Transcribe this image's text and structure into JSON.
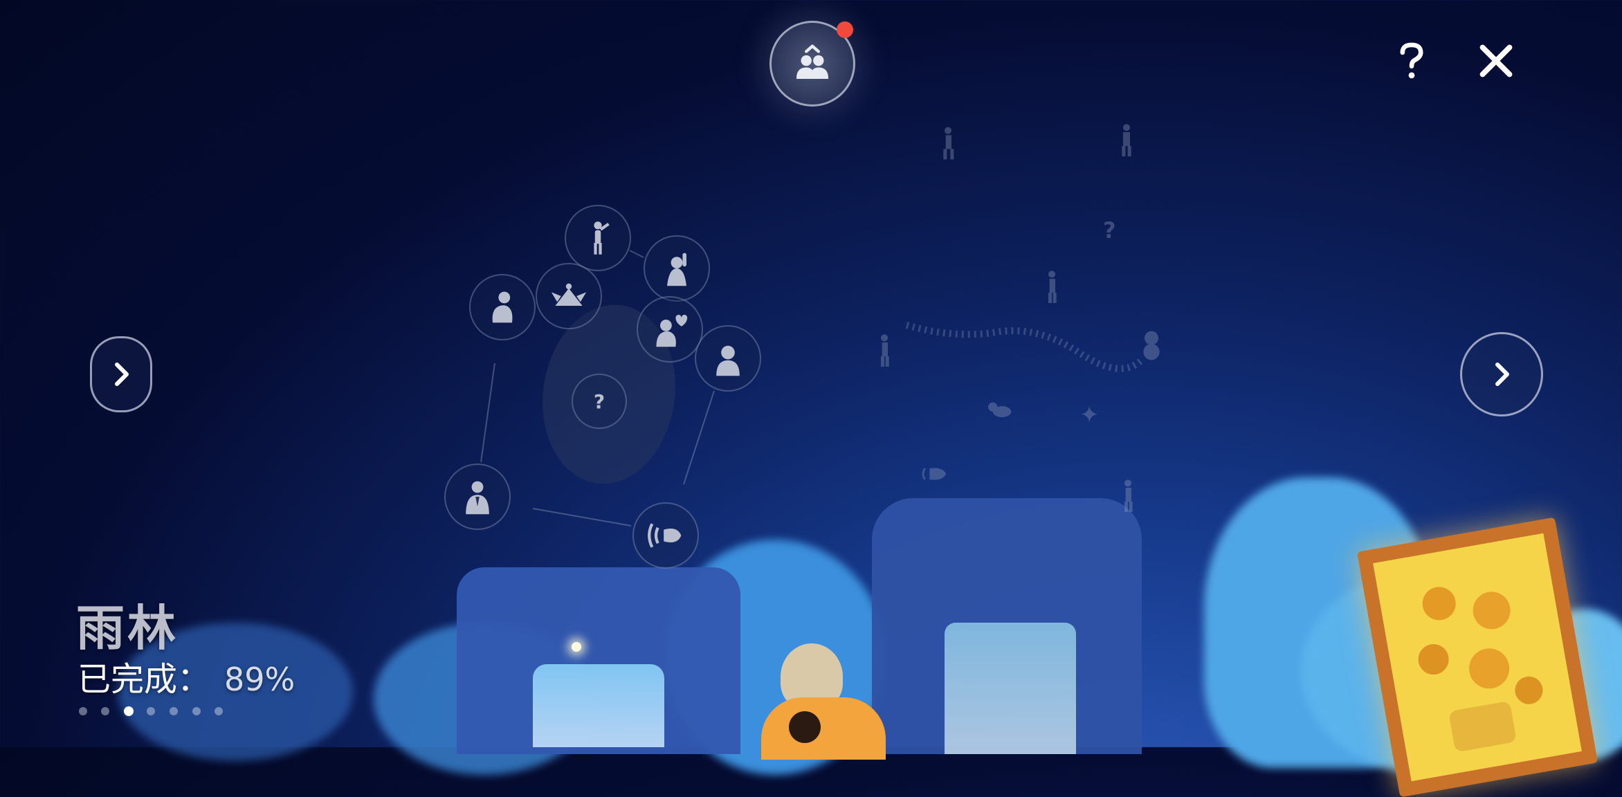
{
  "constellation": {
    "realm_name": "雨林",
    "progress_label": "已完成：",
    "progress_value": "89%",
    "page_count": 7,
    "active_page_index": 2
  },
  "icons": {
    "top_center": "friends-constellation-icon",
    "help": "help-question-icon",
    "close": "close-x-icon",
    "nav_left": "chevron-right-icon",
    "nav_right": "chevron-right-icon"
  },
  "colors": {
    "notification_dot": "#f04a3c",
    "sky_dark": "#020824",
    "sky_mid": "#0d2261",
    "cloud": "#5fb4ea",
    "painting_frame": "#c9722a",
    "painting_canvas": "#f6d44a"
  }
}
